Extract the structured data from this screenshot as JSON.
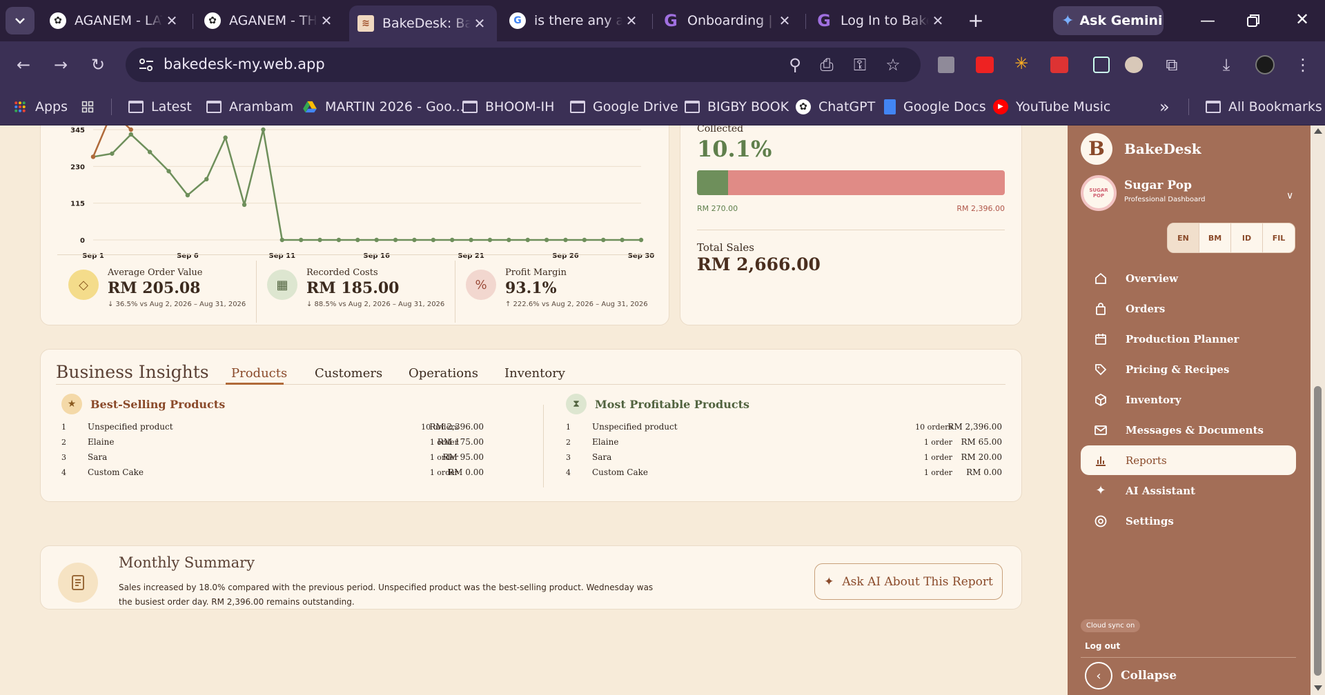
{
  "browser": {
    "tabs": [
      {
        "title": "AGANEM - LATE",
        "icon": "chatgpt-icon"
      },
      {
        "title": "AGANEM - THE",
        "icon": "chatgpt-icon"
      },
      {
        "title": "BakeDesk: Bake",
        "icon": "bakedesk-icon",
        "active": true
      },
      {
        "title": "is there any ai",
        "icon": "google-icon"
      },
      {
        "title": "Onboarding | C",
        "icon": "g-icon"
      },
      {
        "title": "Log In to Bake",
        "icon": "g-icon"
      }
    ],
    "new_tab_label": "+",
    "gemini_label": "Ask Gemini",
    "url": "bakedesk-my.web.app",
    "bookmarks": [
      {
        "label": "Apps",
        "icon": "apps-grid-icon"
      },
      {
        "label": "",
        "icon": "tab-groups-icon"
      },
      {
        "label": "Latest",
        "icon": "folder-icon"
      },
      {
        "label": "Arambam",
        "icon": "folder-icon"
      },
      {
        "label": "MARTIN 2026 - Goo...",
        "icon": "google-drive-icon"
      },
      {
        "label": "BHOOM-IH",
        "icon": "folder-icon"
      },
      {
        "label": "Google Drive",
        "icon": "folder-icon"
      },
      {
        "label": "BIGBY BOOK",
        "icon": "folder-icon"
      },
      {
        "label": "ChatGPT",
        "icon": "chatgpt-icon"
      },
      {
        "label": "Google Docs",
        "icon": "google-docs-icon"
      },
      {
        "label": "YouTube Music",
        "icon": "youtube-music-icon"
      }
    ],
    "more_bookmarks": "»",
    "all_bookmarks": "All Bookmarks"
  },
  "colors": {
    "page_bg": "#f7ebd9",
    "card_bg": "#fdf6ec",
    "sidebar_bg": "#a36e57",
    "accent_brown": "#8a4a2a",
    "green": "#6e8f5b",
    "orange_line": "#b06a3a",
    "collected_bar": "#e08b86"
  },
  "chart_data": {
    "type": "line",
    "x_ticks": [
      "Sep 1",
      "Sep 6",
      "Sep 11",
      "Sep 16",
      "Sep 21",
      "Sep 26",
      "Sep 30"
    ],
    "y_ticks": [
      "0",
      "115",
      "230",
      "345"
    ],
    "ylim": [
      0,
      345
    ],
    "grid": true,
    "series": [
      {
        "values": [
          260,
          270,
          330,
          275,
          215,
          140,
          190,
          320,
          110,
          345,
          0,
          0,
          0,
          0,
          0,
          0,
          0,
          0,
          0,
          0,
          0,
          0,
          0,
          0,
          0,
          0,
          0,
          0,
          0,
          0
        ],
        "color": "#6e8f5b"
      },
      {
        "values": [
          260,
          400,
          345
        ],
        "color": "#b06a3a"
      }
    ]
  },
  "kpis": [
    {
      "label": "Average Order Value",
      "value": "RM 205.08",
      "compare": "↓ 36.5% vs Aug 2, 2026 – Aug 31, 2026",
      "icon": "diamond-icon",
      "badge_color": "#f4dc8b",
      "icon_color": "#8a5a20"
    },
    {
      "label": "Recorded Costs",
      "value": "RM 185.00",
      "compare": "↓ 88.5% vs Aug 2, 2026 – Aug 31, 2026",
      "icon": "cost-square-icon",
      "badge_color": "#dde6d0",
      "icon_color": "#51633f"
    },
    {
      "label": "Profit Margin",
      "value": "93.1%",
      "compare": "↑ 222.6% vs Aug 2, 2026 – Aug 31, 2026",
      "icon": "percent-icon",
      "badge_color": "#f2d7cf",
      "icon_color": "#9a4a38"
    }
  ],
  "collection": {
    "label": "Collected",
    "percent_text": "10.1%",
    "percent_value": 0.101,
    "collected_amount": "RM 270.00",
    "total_amount": "RM 2,396.00",
    "total_sales_label": "Total Sales",
    "total_sales_value": "RM 2,666.00"
  },
  "insights": {
    "title": "Business Insights",
    "tabs": [
      "Products",
      "Customers",
      "Operations",
      "Inventory"
    ],
    "active_tab": "Products",
    "best_selling": {
      "title": "Best-Selling Products",
      "icon": "star-icon",
      "rows": [
        {
          "rank": "1",
          "product": "Unspecified product",
          "orders": "10 orders",
          "amount": "RM 2,396.00"
        },
        {
          "rank": "2",
          "product": "Elaine",
          "orders": "1 order",
          "amount": "RM 175.00"
        },
        {
          "rank": "3",
          "product": "Sara",
          "orders": "1 order",
          "amount": "RM 95.00"
        },
        {
          "rank": "4",
          "product": "Custom Cake",
          "orders": "1 order",
          "amount": "RM 0.00"
        }
      ]
    },
    "most_profitable": {
      "title": "Most Profitable Products",
      "icon": "hourglass-icon",
      "rows": [
        {
          "rank": "1",
          "product": "Unspecified product",
          "orders": "10 orders",
          "amount": "RM 2,396.00"
        },
        {
          "rank": "2",
          "product": "Elaine",
          "orders": "1 order",
          "amount": "RM 65.00"
        },
        {
          "rank": "3",
          "product": "Sara",
          "orders": "1 order",
          "amount": "RM 20.00"
        },
        {
          "rank": "4",
          "product": "Custom Cake",
          "orders": "1 order",
          "amount": "RM 0.00"
        }
      ]
    }
  },
  "summary": {
    "title": "Monthly Summary",
    "text": "Sales increased by 18.0% compared with the previous period. Unspecified product was the best-selling product. Wednesday was the busiest order day. RM 2,396.00 remains outstanding.",
    "ask_ai_label": "Ask AI About This Report",
    "icon": "document-icon"
  },
  "sidebar": {
    "brand_letter": "B",
    "brand": "BakeDesk",
    "shop_name": "Sugar Pop",
    "shop_subtitle": "Professional Dashboard",
    "shop_logo_text": "SUGAR POP",
    "languages": [
      "EN",
      "BM",
      "ID",
      "FIL"
    ],
    "active_language": "EN",
    "nav": [
      {
        "label": "Overview",
        "icon": "home-icon"
      },
      {
        "label": "Orders",
        "icon": "shopping-bag-icon"
      },
      {
        "label": "Production Planner",
        "icon": "calendar-icon"
      },
      {
        "label": "Pricing & Recipes",
        "icon": "tag-icon"
      },
      {
        "label": "Inventory",
        "icon": "box-icon"
      },
      {
        "label": "Messages & Documents",
        "icon": "mail-icon"
      },
      {
        "label": "Reports",
        "icon": "bar-chart-icon",
        "active": true
      },
      {
        "label": "AI Assistant",
        "icon": "sparkle-icon"
      },
      {
        "label": "Settings",
        "icon": "settings-icon"
      }
    ],
    "cloud_sync": "Cloud sync on",
    "logout": "Log out",
    "collapse": "Collapse"
  }
}
